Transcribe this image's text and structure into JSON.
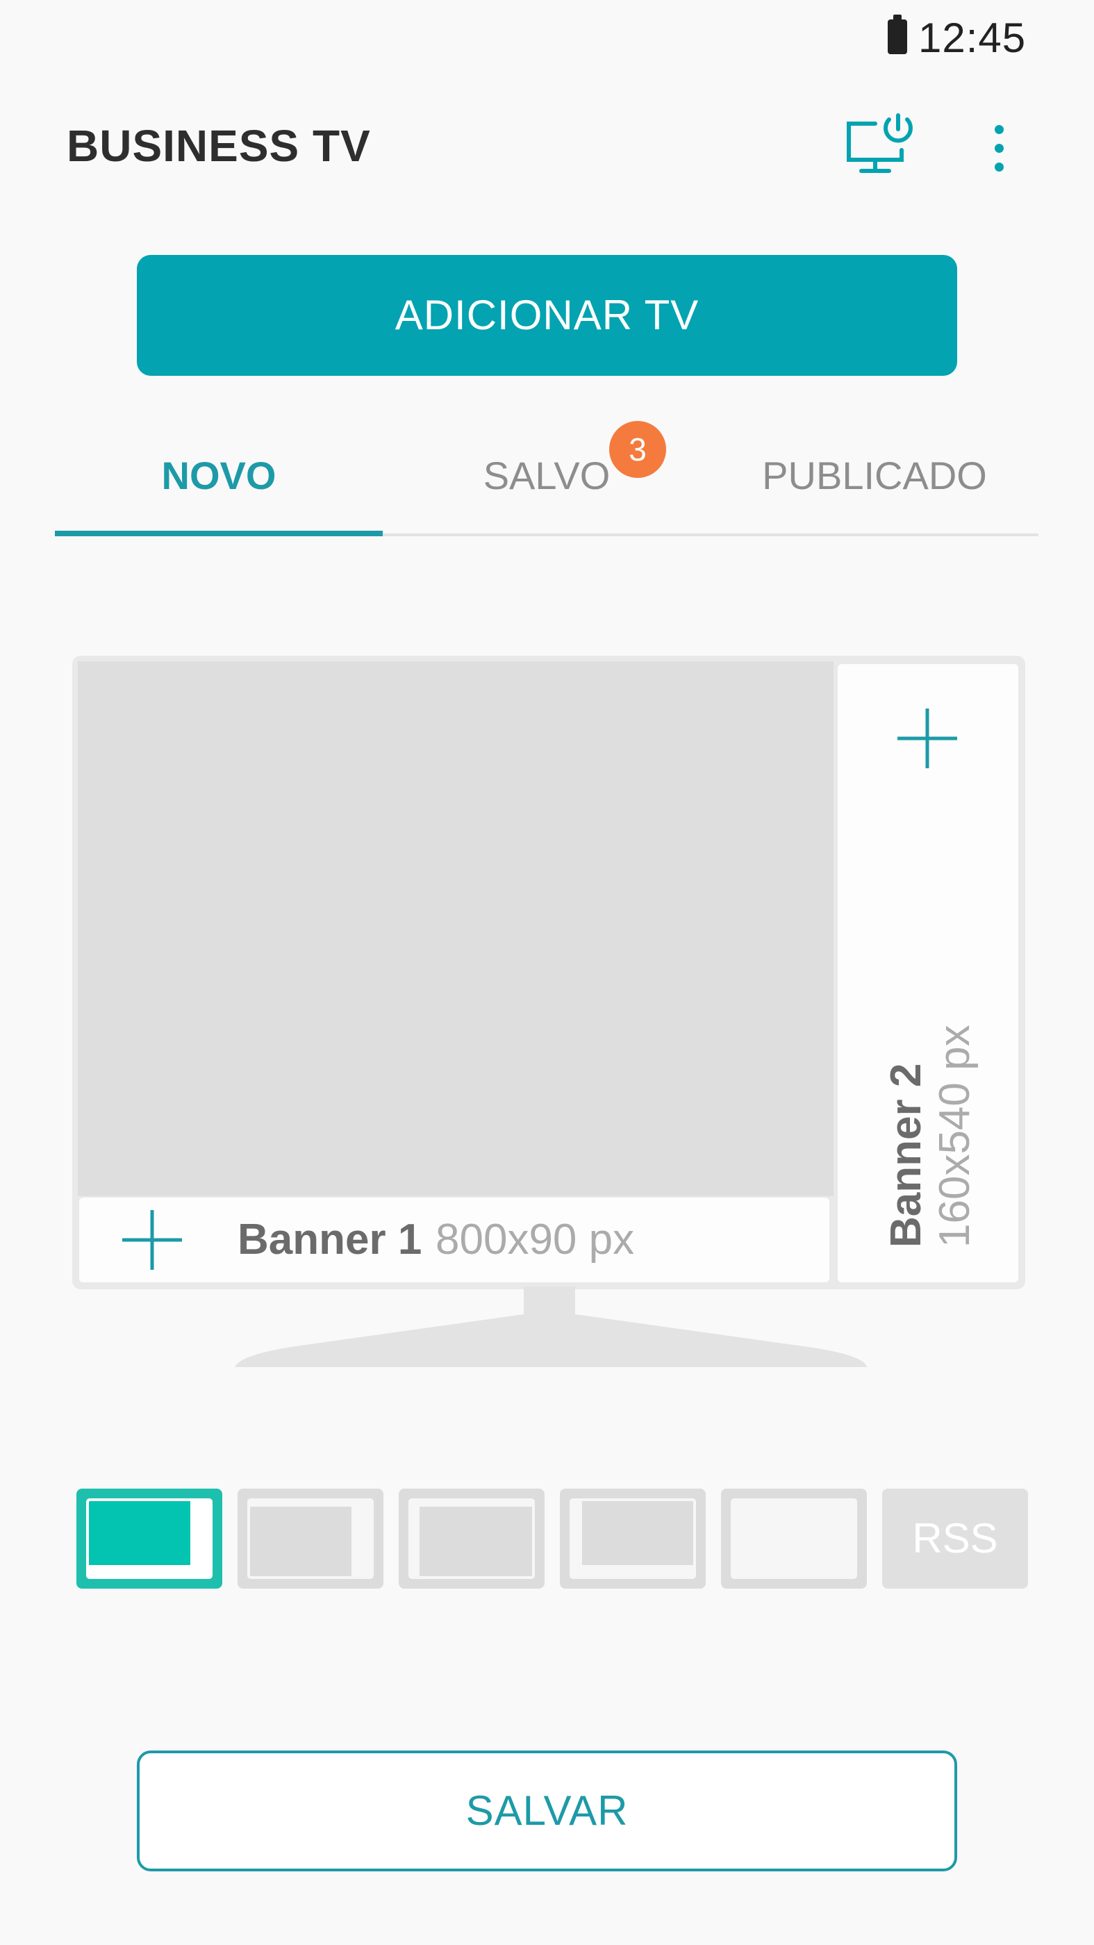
{
  "status_bar": {
    "time": "12:45",
    "battery_icon": "battery-icon"
  },
  "app_bar": {
    "title": "BUSINESS TV",
    "tv_power_icon": "tv-power-icon",
    "overflow_icon": "more-vert-icon"
  },
  "add_tv_button": {
    "label": "ADICIONAR TV"
  },
  "tabs": [
    {
      "label": "NOVO",
      "selected": true
    },
    {
      "label": "SALVO",
      "badge": "3"
    },
    {
      "label": "PUBLICADO"
    }
  ],
  "tv_preview": {
    "banner1": {
      "name": "Banner 1",
      "size": "800x90 px"
    },
    "banner2": {
      "name": "Banner 2",
      "size": "160x540 px"
    },
    "add_icon": "plus-icon"
  },
  "layouts": {
    "selected_index": 0,
    "rss_label": "RSS"
  },
  "save_button": {
    "label": "SALVAR"
  },
  "colors": {
    "accent": "#03a3b1",
    "tab_active": "#1d9aa8",
    "badge": "#f47b3d",
    "layout_selected": "#02c4b0",
    "background": "#f9f9f9"
  }
}
